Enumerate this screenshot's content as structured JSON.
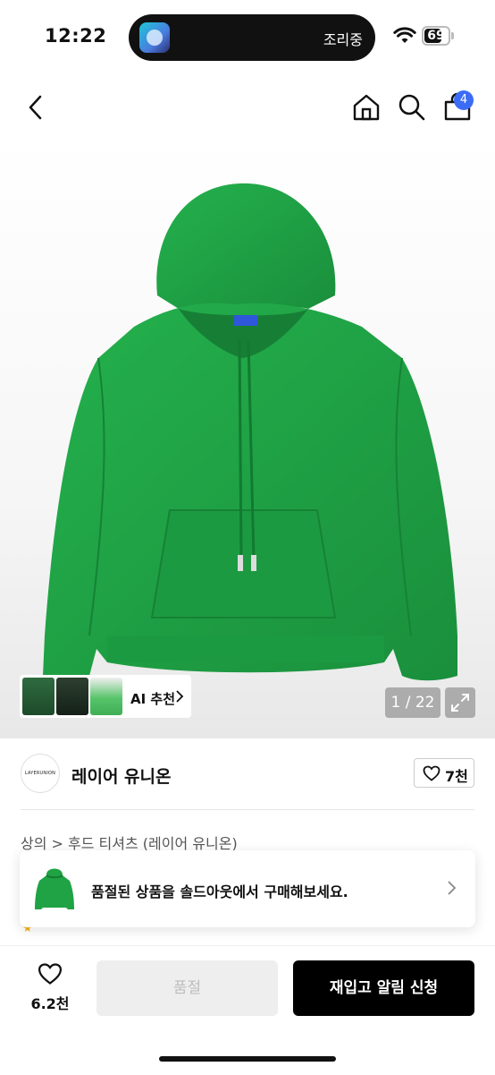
{
  "status_bar": {
    "time": "12:22",
    "activity_text": "조리중",
    "battery_level": "69",
    "battery_fraction": 0.69
  },
  "nav": {
    "back_icon": "chevron-left-icon",
    "home_icon": "home-icon",
    "search_icon": "search-icon",
    "cart_icon": "shopping-bag-icon",
    "cart_badge": "4",
    "accent_color": "#3b6cf6"
  },
  "product_image": {
    "main_color": "#1fa344",
    "ai_recommend_label": "AI 추천",
    "image_counter": "1 / 22",
    "expand_icon": "expand-icon"
  },
  "brand": {
    "logo_text": "LAYERUNION",
    "name": "레이어 유니온",
    "like_count": "7천"
  },
  "breadcrumb": {
    "text": "상의 > 후드 티셔츠 (레이어 유니온)"
  },
  "soldout_banner": {
    "message": "품절된 상품을 솔드아웃에서 구매해보세요."
  },
  "bottom_bar": {
    "wishlist_count": "6.2천",
    "soldout_label": "품절",
    "restock_label": "재입고 알림 신청"
  }
}
